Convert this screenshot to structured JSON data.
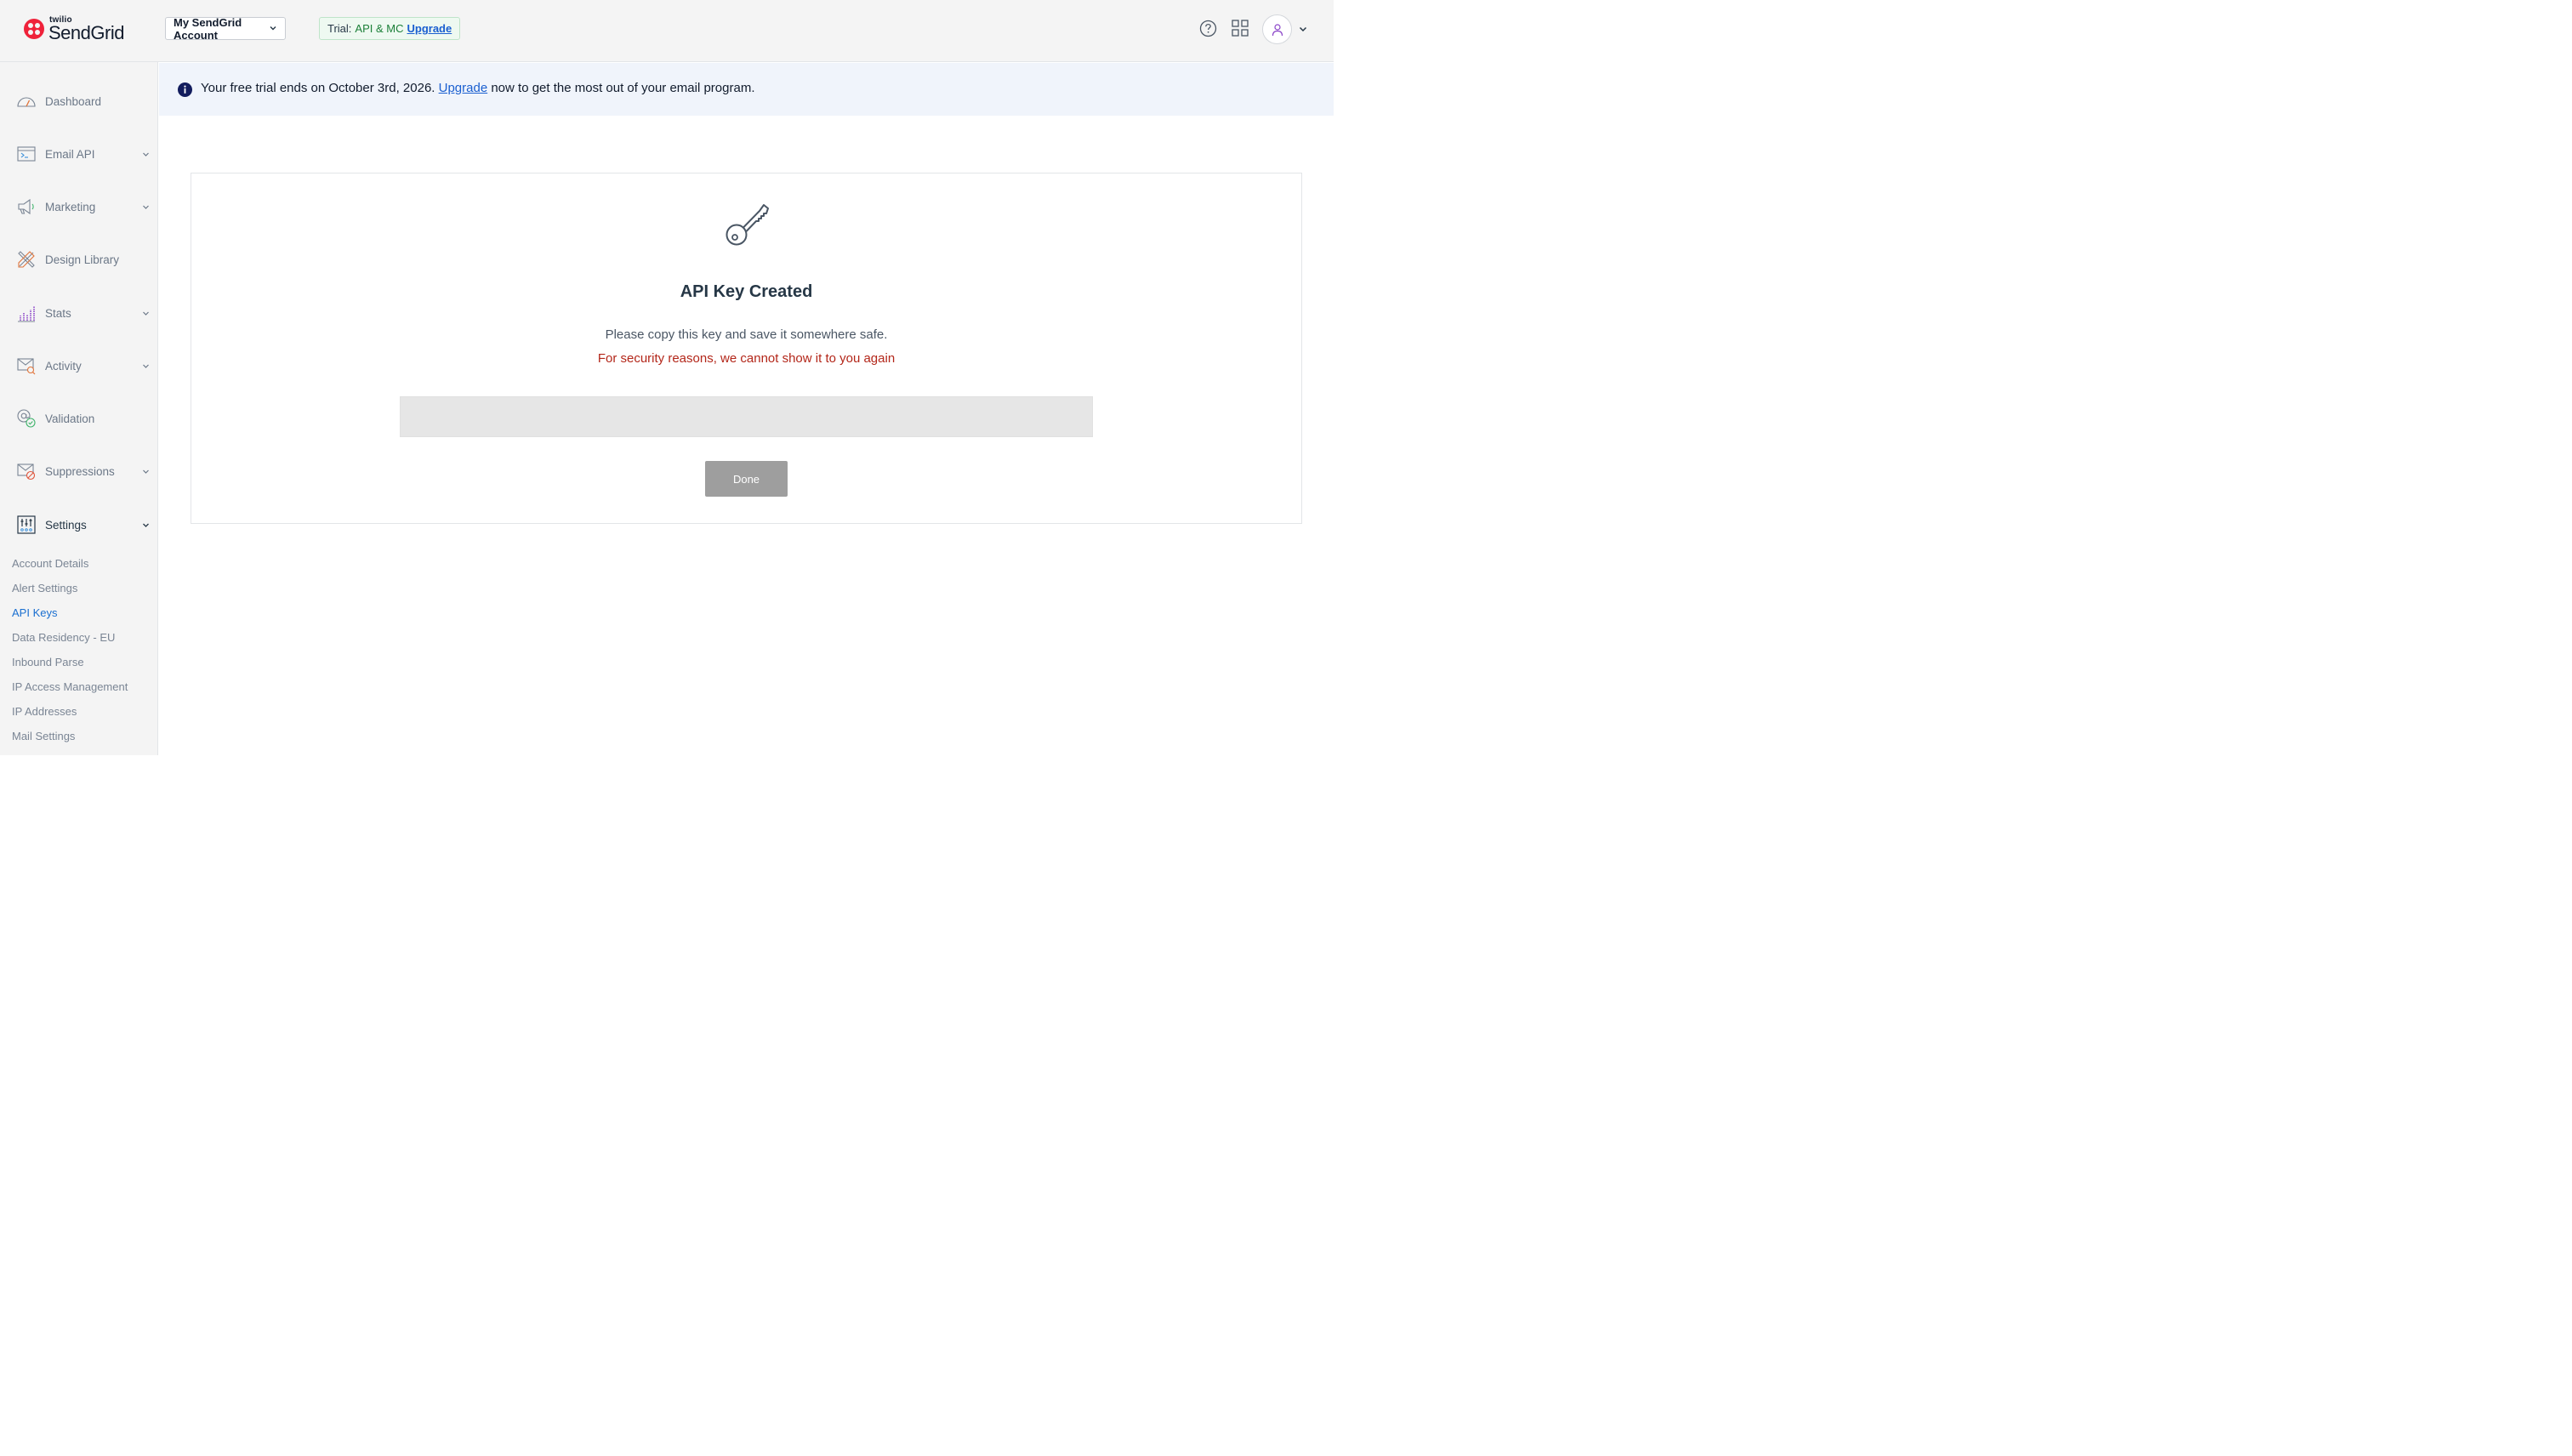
{
  "header": {
    "logo_small": "twilio",
    "logo_main": "SendGrid",
    "account_label": "My SendGrid Account",
    "trial_label": "Trial:",
    "trial_plan": "API & MC",
    "trial_upgrade": "Upgrade"
  },
  "sidebar": {
    "items": [
      {
        "label": "Dashboard",
        "icon": "dashboard-gauge-icon",
        "has_chevron": false
      },
      {
        "label": "Email API",
        "icon": "terminal-window-icon",
        "has_chevron": true
      },
      {
        "label": "Marketing",
        "icon": "megaphone-icon",
        "has_chevron": true
      },
      {
        "label": "Design Library",
        "icon": "pencil-ruler-icon",
        "has_chevron": false
      },
      {
        "label": "Stats",
        "icon": "bar-chart-icon",
        "has_chevron": true
      },
      {
        "label": "Activity",
        "icon": "envelope-search-icon",
        "has_chevron": true
      },
      {
        "label": "Validation",
        "icon": "at-check-icon",
        "has_chevron": false
      },
      {
        "label": "Suppressions",
        "icon": "envelope-block-icon",
        "has_chevron": true
      },
      {
        "label": "Settings",
        "icon": "sliders-icon",
        "has_chevron": true,
        "active": true
      }
    ],
    "sub_items": [
      {
        "label": "Account Details"
      },
      {
        "label": "Alert Settings"
      },
      {
        "label": "API Keys",
        "active": true
      },
      {
        "label": "Data Residency - EU"
      },
      {
        "label": "Inbound Parse"
      },
      {
        "label": "IP Access Management"
      },
      {
        "label": "IP Addresses"
      },
      {
        "label": "Mail Settings"
      }
    ]
  },
  "banner": {
    "text_before": "Your free trial ends on October 3rd, 2026. ",
    "link": "Upgrade",
    "text_after": " now to get the most out of your email program."
  },
  "card": {
    "title": "API Key Created",
    "line1": "Please copy this key and save it somewhere safe.",
    "line2": "For security reasons, we cannot show it to you again",
    "key_value": "",
    "done_label": "Done"
  },
  "colors": {
    "brand_red": "#ef223a",
    "link_blue": "#1a5fd0",
    "warning_red": "#b32619",
    "disabled_button": "#9e9e9e"
  }
}
